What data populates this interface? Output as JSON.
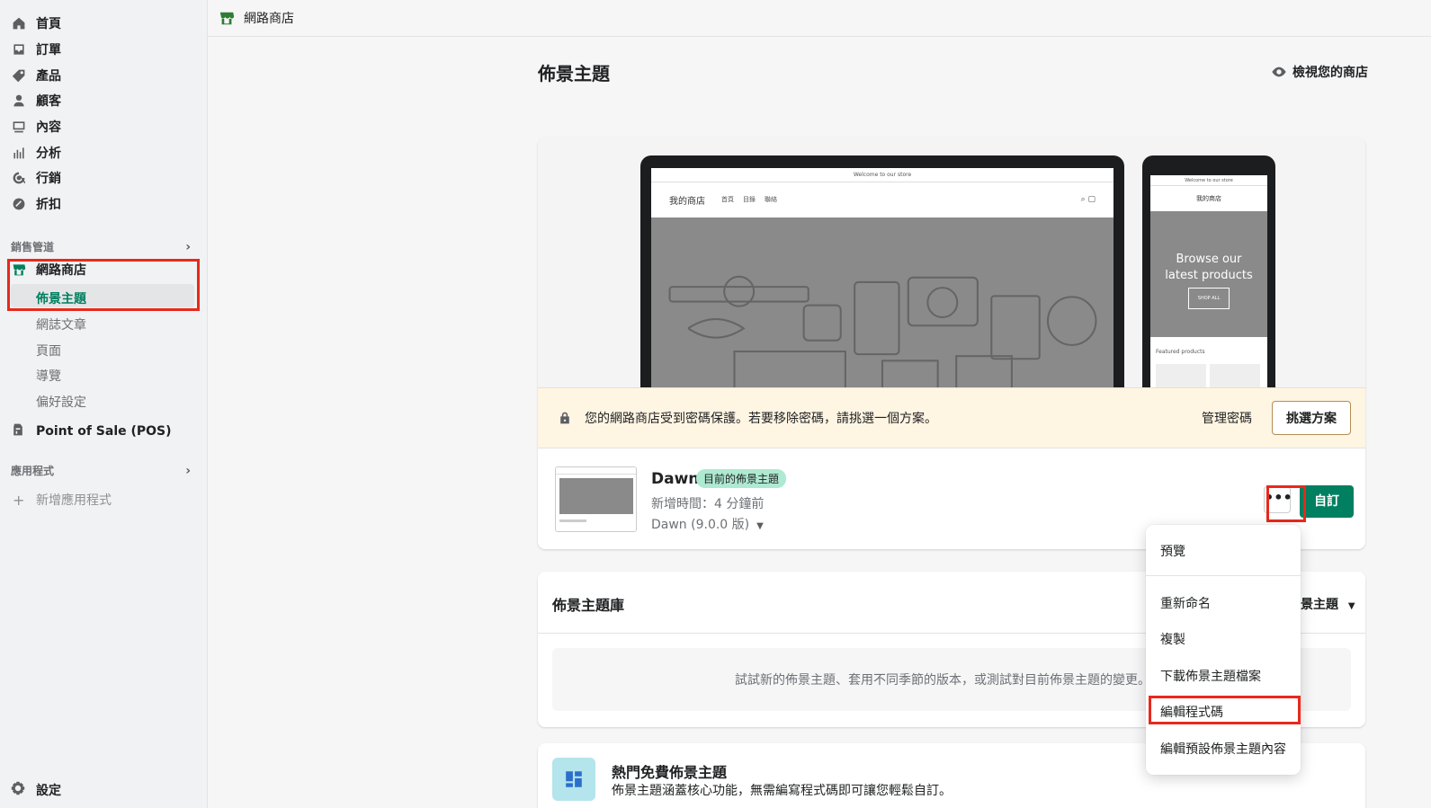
{
  "topbar": {
    "store_name": "網路商店"
  },
  "sidebar": {
    "items": [
      {
        "label": "首頁",
        "icon": "home-icon"
      },
      {
        "label": "訂單",
        "icon": "orders-icon"
      },
      {
        "label": "產品",
        "icon": "tag-icon"
      },
      {
        "label": "顧客",
        "icon": "customer-icon"
      },
      {
        "label": "內容",
        "icon": "content-icon"
      },
      {
        "label": "分析",
        "icon": "analytics-icon"
      },
      {
        "label": "行銷",
        "icon": "marketing-icon"
      },
      {
        "label": "折扣",
        "icon": "discount-icon"
      }
    ],
    "sales_channels_label": "銷售管道",
    "online_store_label": "網路商店",
    "online_store_sub": [
      "佈景主題",
      "網誌文章",
      "頁面",
      "導覽",
      "偏好設定"
    ],
    "pos_label": "Point of Sale (POS)",
    "apps_label": "應用程式",
    "add_app_label": "新增應用程式",
    "settings_label": "設定"
  },
  "main": {
    "title": "佈景主題",
    "view_store": "檢視您的商店",
    "preview": {
      "laptop_announcement": "Welcome to our store",
      "laptop_store_name": "我的商店",
      "laptop_links": [
        "首頁",
        "目錄",
        "聯絡"
      ],
      "phone_announcement": "Welcome to our store",
      "phone_store_name": "我的商店",
      "phone_hero_line1": "Browse our",
      "phone_hero_line2": "latest products",
      "phone_hero_button": "SHOP ALL",
      "phone_featured": "Featured products"
    },
    "notice": {
      "message": "您的網路商店受到密碼保護。若要移除密碼，請挑選一個方案。",
      "manage_password": "管理密碼",
      "choose_plan": "挑選方案"
    },
    "current_theme": {
      "name": "Dawn",
      "badge": "目前的佈景主題",
      "added": "新增時間：4 分鐘前",
      "version": "Dawn (9.0.0 版)",
      "more_label": "•••",
      "customize": "自訂"
    },
    "library": {
      "title": "佈景主題庫",
      "sort_label": "景主題",
      "text": "試試新的佈景主題、套用不同季節的版本，或測試對目前佈景主題的變更。"
    },
    "free_themes": {
      "title": "熱門免費佈景主題",
      "desc": "佈景主題涵蓋核心功能，無需編寫程式碼即可讓您輕鬆自訂。"
    }
  },
  "menu": {
    "items": [
      "預覽",
      "重新命名",
      "複製",
      "下載佈景主題檔案",
      "編輯程式碼",
      "編輯預設佈景主題內容"
    ]
  },
  "colors": {
    "accent": "#008060",
    "highlight": "#e8291c",
    "notice_bg": "#fff5e3"
  }
}
